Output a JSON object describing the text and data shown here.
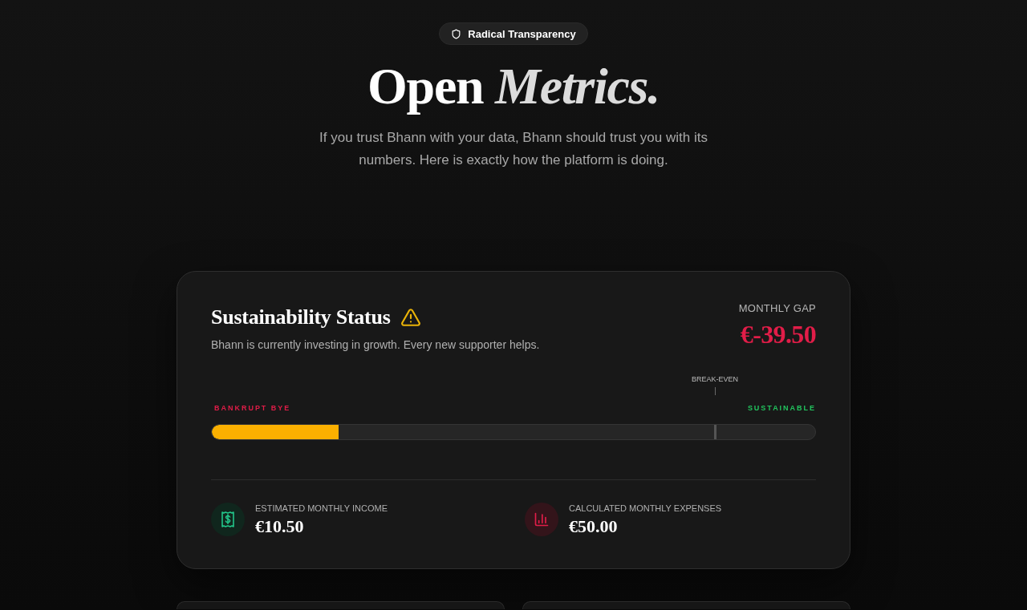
{
  "badge": {
    "label": "Radical Transparency"
  },
  "hero": {
    "title": "Open *Metrics.*",
    "subtitle": "If you trust Bhann with your data, Bhann should trust you with its numbers. Here is exactly how the platform is doing."
  },
  "status_card": {
    "title": "Sustainability Status",
    "warning": true,
    "description": "Bhann is currently investing in growth. Every new supporter helps.",
    "gap": {
      "label": "MONTHLY GAP",
      "value": "€-39.50",
      "negative": true
    },
    "meter": {
      "low_label": "BANKRUPT BYE",
      "high_label": "SUSTAINABLE",
      "level": 0.21,
      "break_even": {
        "label": "BREAK-EVEN",
        "level": 0.833
      }
    },
    "stats": [
      {
        "kind": "income",
        "label": "ESTIMATED MONTHLY INCOME",
        "value": "€10.50"
      },
      {
        "kind": "expenses",
        "label": "CALCULATED MONTHLY EXPENSES",
        "value": "€50.00"
      }
    ]
  }
}
